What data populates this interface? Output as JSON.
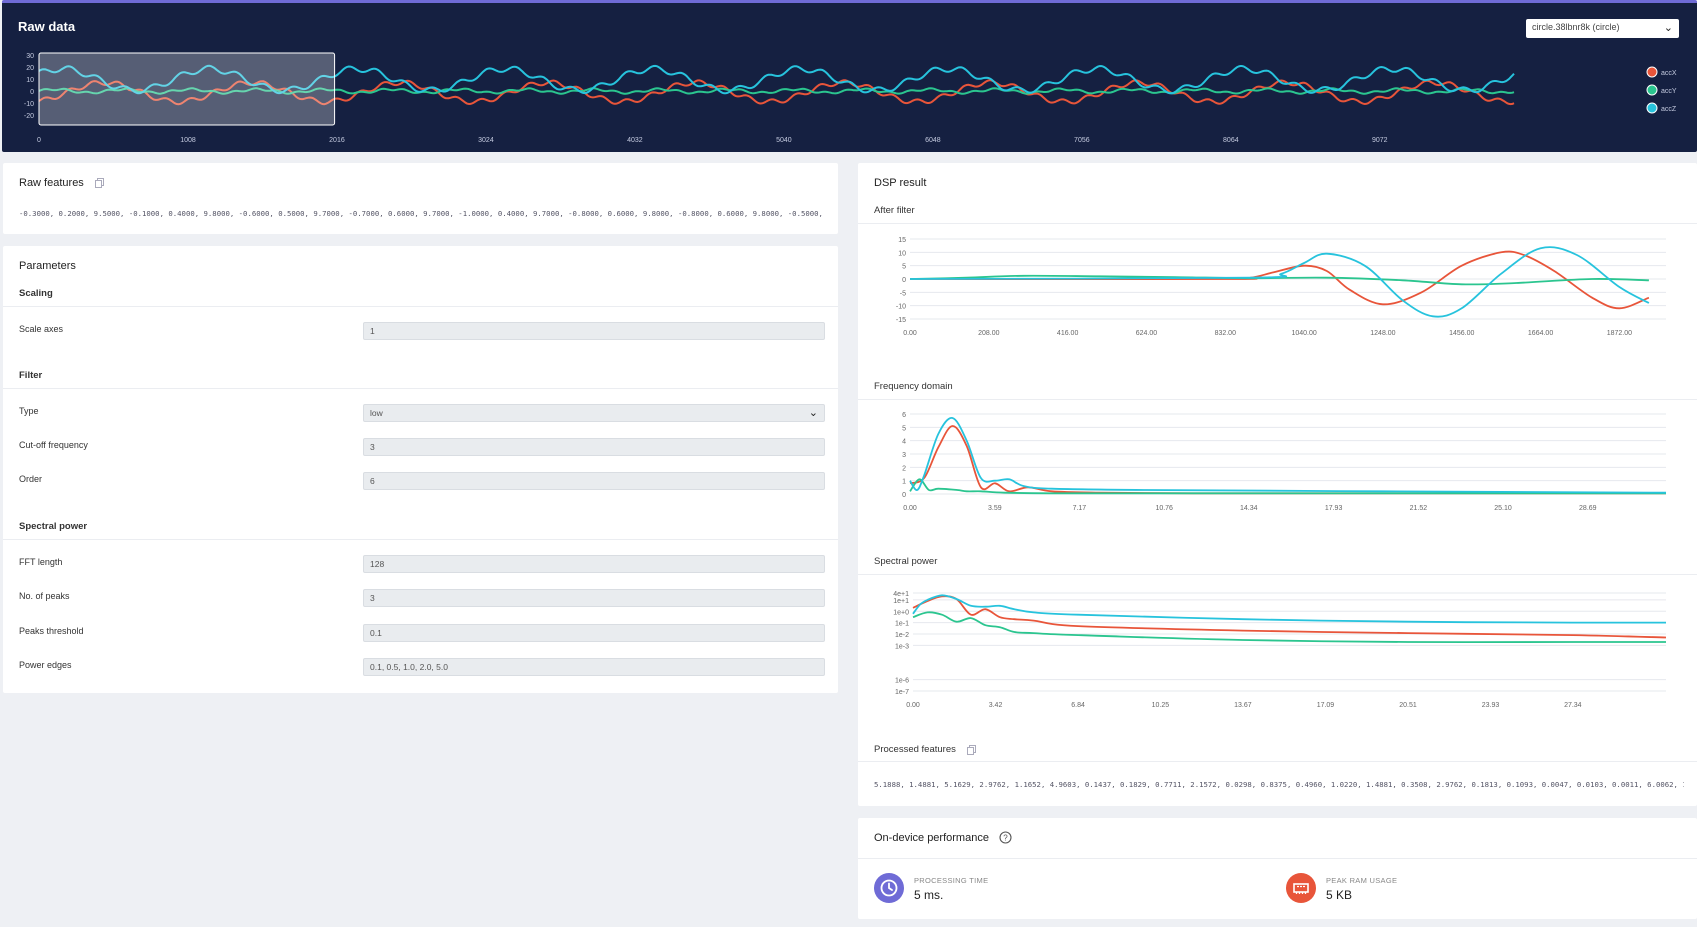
{
  "raw_data": {
    "title": "Raw data",
    "sample_select": "circle.38lbnr8k (circle)",
    "legend": [
      {
        "name": "accX",
        "color": "#e8553a"
      },
      {
        "name": "accY",
        "color": "#2bc58f"
      },
      {
        "name": "accZ",
        "color": "#27c3dd"
      }
    ]
  },
  "raw_features": {
    "title": "Raw features",
    "values": "-0.3000, 0.2000, 9.5000, -0.1000, 0.4000, 9.8000, -0.6000, 0.5000, 9.7000, -0.7000, 0.6000, 9.7000, -1.0000, 0.4000, 9.7000, -0.8000, 0.6000, 9.8000, -0.8000, 0.6000, 9.8000, -0.5000, 0.5000, 9..."
  },
  "parameters": {
    "title": "Parameters",
    "scaling": {
      "title": "Scaling",
      "scale_axes_label": "Scale axes",
      "scale_axes_value": "1"
    },
    "filter": {
      "title": "Filter",
      "type_label": "Type",
      "type_value": "low",
      "cutoff_label": "Cut-off frequency",
      "cutoff_value": "3",
      "order_label": "Order",
      "order_value": "6"
    },
    "spectral": {
      "title": "Spectral power",
      "fft_label": "FFT length",
      "fft_value": "128",
      "peaks_label": "No. of peaks",
      "peaks_value": "3",
      "threshold_label": "Peaks threshold",
      "threshold_value": "0.1",
      "edges_label": "Power edges",
      "edges_value": "0.1, 0.5, 1.0, 2.0, 5.0"
    }
  },
  "dsp": {
    "title": "DSP result",
    "after_filter_title": "After filter",
    "freq_title": "Frequency domain",
    "spectral_title": "Spectral power",
    "processed_title": "Processed features",
    "processed_values": "5.1888, 1.4881, 5.1629, 2.9762, 1.1652, 4.9603, 0.1437, 0.1829, 0.7711, 2.1572, 0.0298, 0.8375, 0.4960, 1.0220, 1.4881, 0.3508, 2.9762, 0.1813, 0.1093, 0.0047, 0.0103, 0.0011, 6.0062, 1.4881, 5..."
  },
  "performance": {
    "title": "On-device performance",
    "processing_caption": "PROCESSING TIME",
    "processing_value": "5 ms.",
    "ram_caption": "PEAK RAM USAGE",
    "ram_value": "5 KB"
  },
  "colors": {
    "accX": "#e8553a",
    "accY": "#2bc58f",
    "accZ": "#27c3dd",
    "header_bg": "#152041",
    "accent": "#6f6bd6"
  },
  "chart_data": [
    {
      "type": "line",
      "title": "Raw data",
      "x_ticks": [
        "0",
        "1008",
        "2016",
        "3024",
        "4032",
        "5040",
        "6048",
        "7056",
        "8064",
        "9072"
      ],
      "y_ticks": [
        "30",
        "20",
        "10",
        "0",
        "-10",
        "-20"
      ],
      "ylim": [
        -20,
        30
      ],
      "xlim": [
        0,
        9980
      ],
      "window": [
        0,
        2000
      ],
      "series": [
        {
          "name": "accX",
          "period": 1000,
          "mean": -1,
          "amplitude": 8
        },
        {
          "name": "accY",
          "period": 1000,
          "mean": 0,
          "amplitude": 1.5
        },
        {
          "name": "accZ",
          "period": 1000,
          "mean": 9.5,
          "amplitude": 9
        }
      ]
    },
    {
      "type": "line",
      "title": "After filter",
      "x_ticks": [
        "0.00",
        "208.00",
        "416.00",
        "624.00",
        "832.00",
        "1040.00",
        "1248.00",
        "1456.00",
        "1664.00",
        "1872.00"
      ],
      "y_ticks": [
        "15",
        "10",
        "5",
        "0",
        "-5",
        "-10",
        "-15"
      ],
      "ylim": [
        -15,
        15
      ],
      "xlim": [
        0,
        1995
      ],
      "series": [
        {
          "name": "accX",
          "x": [
            0,
            832,
            900,
            960,
            1040,
            1100,
            1160,
            1248,
            1350,
            1456,
            1560,
            1620,
            1700,
            1800,
            1872,
            1950
          ],
          "y": [
            0,
            0,
            0.5,
            2.5,
            5,
            3,
            -4,
            -9.5,
            -5,
            5,
            10,
            9,
            3,
            -7,
            -11,
            -7
          ]
        },
        {
          "name": "accY",
          "x": [
            0,
            150,
            300,
            500,
            700,
            900,
            1100,
            1300,
            1456,
            1600,
            1800,
            1950
          ],
          "y": [
            0,
            0.5,
            1.2,
            1,
            0.7,
            0.3,
            0.5,
            -0.5,
            -2,
            -1.5,
            0,
            -0.5
          ]
        },
        {
          "name": "accZ",
          "x": [
            0,
            900,
            980,
            1040,
            1100,
            1200,
            1300,
            1380,
            1456,
            1560,
            1664,
            1760,
            1872,
            1950
          ],
          "y": [
            0,
            0.5,
            2,
            6,
            9.5,
            5,
            -8,
            -14,
            -11,
            2,
            11.5,
            9,
            -3,
            -9
          ]
        }
      ]
    },
    {
      "type": "line",
      "title": "Frequency domain",
      "x_ticks": [
        "0.00",
        "3.59",
        "7.17",
        "10.76",
        "14.34",
        "17.93",
        "21.52",
        "25.10",
        "28.69"
      ],
      "y_ticks": [
        "6",
        "5",
        "4",
        "3",
        "2",
        "1",
        "0"
      ],
      "ylim": [
        0,
        6
      ],
      "xlim": [
        0,
        32
      ],
      "series": [
        {
          "name": "accX",
          "x": [
            0,
            0.6,
            1.2,
            1.8,
            2.4,
            3.0,
            3.6,
            4.2,
            5,
            6,
            8,
            12,
            20,
            32
          ],
          "y": [
            0.8,
            1.2,
            3.5,
            5.1,
            3.6,
            0.5,
            0.8,
            0.2,
            0.5,
            0.2,
            0.1,
            0.05,
            0.05,
            0.05
          ]
        },
        {
          "name": "accY",
          "x": [
            0,
            0.4,
            0.8,
            1.2,
            2,
            2.4,
            3,
            4,
            6,
            10,
            20,
            32
          ],
          "y": [
            0.2,
            1.1,
            0.3,
            0.4,
            0.3,
            0.2,
            0.2,
            0.1,
            0.05,
            0.05,
            0.05,
            0.05
          ]
        },
        {
          "name": "accZ",
          "x": [
            0,
            0.3,
            0.6,
            1.2,
            1.8,
            2.4,
            3.0,
            3.6,
            4.2,
            4.8,
            6,
            10,
            20,
            32
          ],
          "y": [
            1.0,
            0.3,
            1.4,
            4.5,
            5.7,
            4.0,
            1.2,
            1.0,
            1.1,
            0.6,
            0.4,
            0.3,
            0.2,
            0.1
          ]
        }
      ]
    },
    {
      "type": "line",
      "title": "Spectral power",
      "y_scale": "log",
      "x_ticks": [
        "0.00",
        "3.42",
        "6.84",
        "10.25",
        "13.67",
        "17.09",
        "20.51",
        "23.93",
        "27.34"
      ],
      "y_ticks": [
        "4e+1",
        "1e+1",
        "1e+0",
        "1e-1",
        "1e-2",
        "1e-3",
        "1e-6",
        "1e-7"
      ],
      "ylim": [
        1e-07,
        40
      ],
      "xlim": [
        0,
        31.2
      ],
      "series": [
        {
          "name": "accX",
          "x": [
            0,
            0.6,
            1.2,
            1.8,
            2.4,
            3.0,
            3.6,
            4.2,
            5,
            6.84,
            13.67,
            20.51,
            27.34,
            31.2
          ],
          "y": [
            2,
            8,
            20,
            12,
            0.5,
            1.5,
            0.3,
            0.2,
            0.15,
            0.05,
            0.02,
            0.012,
            0.008,
            0.005
          ]
        },
        {
          "name": "accY",
          "x": [
            0,
            0.6,
            1.2,
            1.8,
            2.4,
            3.0,
            3.6,
            4.2,
            5,
            6.84,
            13.67,
            20.51,
            27.34,
            31.2
          ],
          "y": [
            0.3,
            0.8,
            0.5,
            0.12,
            0.25,
            0.06,
            0.04,
            0.015,
            0.012,
            0.008,
            0.003,
            0.002,
            0.002,
            0.002
          ]
        },
        {
          "name": "accZ",
          "x": [
            0,
            0.3,
            0.6,
            1.2,
            1.8,
            2.4,
            3.0,
            3.6,
            4.2,
            5,
            6.84,
            13.67,
            20.51,
            27.34,
            31.2
          ],
          "y": [
            0.6,
            4,
            10,
            25,
            12,
            3,
            2.5,
            3,
            1.5,
            0.8,
            0.5,
            0.2,
            0.12,
            0.1,
            0.1
          ]
        }
      ]
    }
  ]
}
